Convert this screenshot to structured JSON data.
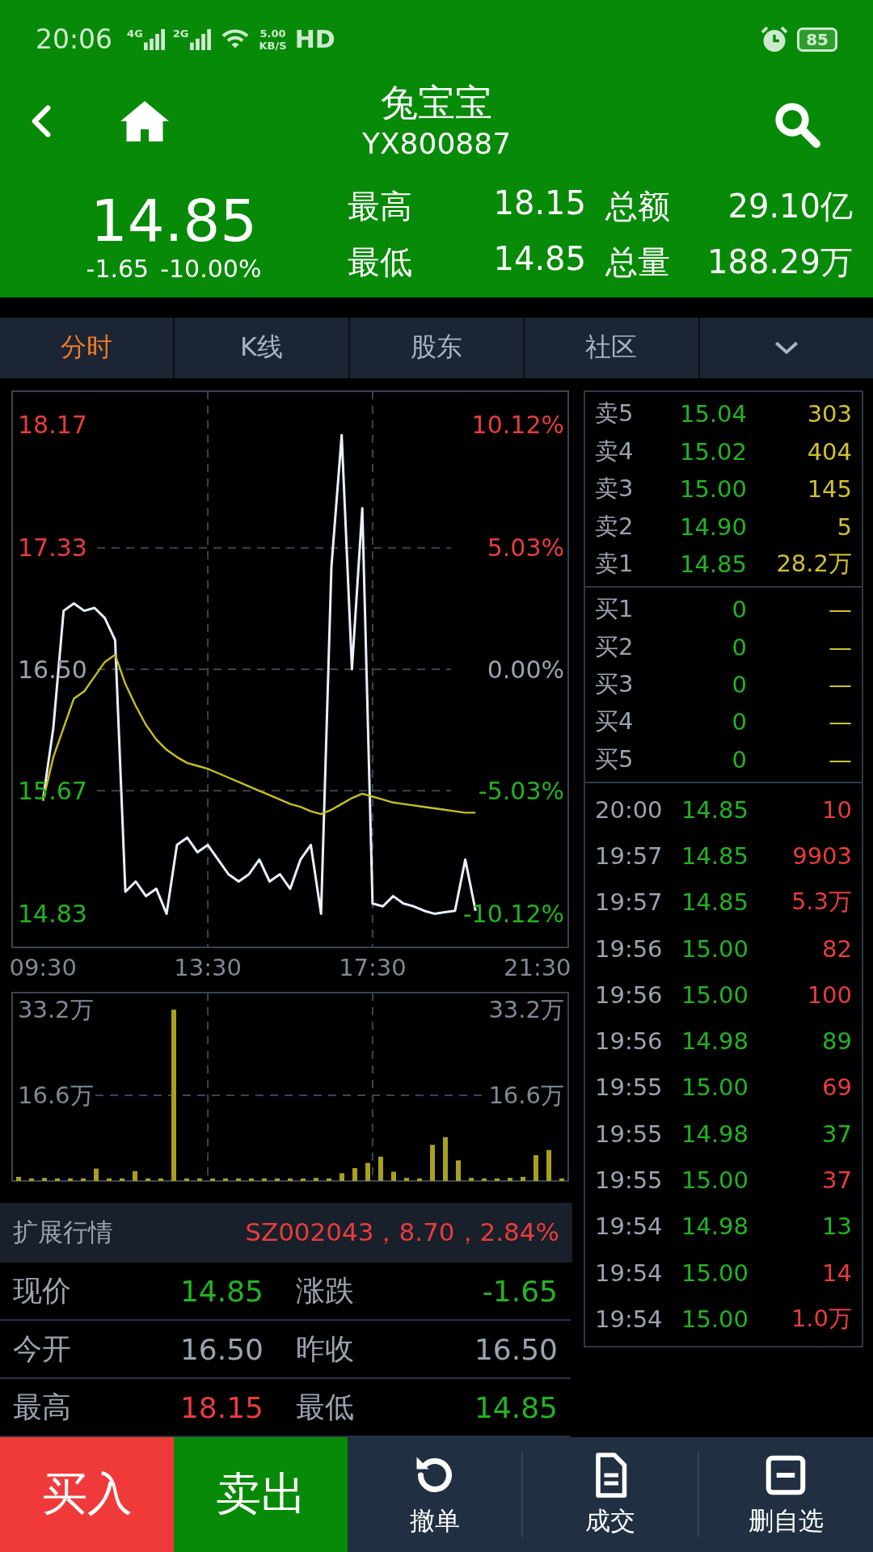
{
  "status_bar": {
    "time": "20:06",
    "networks": [
      "4G",
      "2G"
    ],
    "speed_value": "5.00",
    "speed_unit": "KB/S",
    "hd": "HD",
    "battery": "85"
  },
  "header": {
    "title": "兔宝宝",
    "code": "YX800887",
    "price": "14.85",
    "change": "-1.65",
    "change_pct": "-10.00%",
    "stats": [
      {
        "label": "最高",
        "value": "18.15"
      },
      {
        "label": "总额",
        "value": "29.10亿"
      },
      {
        "label": "最低",
        "value": "14.85"
      },
      {
        "label": "总量",
        "value": "188.29万"
      }
    ]
  },
  "tabs": [
    {
      "label": "分时",
      "selected": true
    },
    {
      "label": "K线",
      "selected": false
    },
    {
      "label": "股东",
      "selected": false
    },
    {
      "label": "社区",
      "selected": false
    }
  ],
  "price_chart": {
    "pct_labels": [
      "10.12%",
      "5.03%",
      "0.00%",
      "-5.03%",
      "-10.12%"
    ],
    "chart_data": {
      "type": "line",
      "grid": true,
      "ref_lines": [
        {
          "axis": "y",
          "value": 17.33
        },
        {
          "axis": "y",
          "value": 16.5
        },
        {
          "axis": "y",
          "value": 15.67
        }
      ],
      "xlim": [
        8.75,
        22.25
      ],
      "ylim": [
        14.6,
        18.4
      ],
      "xticks": [
        {
          "value": 9.5,
          "label": "09:30"
        },
        {
          "value": 13.5,
          "label": "13:30"
        },
        {
          "value": 17.5,
          "label": "17:30"
        },
        {
          "value": 21.5,
          "label": "21:30"
        }
      ],
      "yticks": [
        {
          "value": 18.17,
          "label": "18.17"
        },
        {
          "value": 17.33,
          "label": "17.33"
        },
        {
          "value": 16.5,
          "label": "16.50"
        },
        {
          "value": 15.67,
          "label": "15.67"
        },
        {
          "value": 14.83,
          "label": "14.83"
        }
      ],
      "x": [
        9.5,
        9.75,
        10,
        10.25,
        10.5,
        10.75,
        11,
        11.25,
        11.5,
        11.75,
        12,
        12.25,
        12.5,
        12.75,
        13,
        13.25,
        13.5,
        13.75,
        14,
        14.25,
        14.5,
        14.75,
        15,
        15.25,
        15.5,
        15.75,
        16,
        16.25,
        16.5,
        16.75,
        17,
        17.25,
        17.5,
        17.75,
        18,
        18.25,
        18.5,
        18.75,
        19,
        19.25,
        19.5,
        19.75,
        20
      ],
      "series": [
        {
          "color": "#e8f0ff",
          "values": [
            15.61,
            16.1,
            16.9,
            16.95,
            16.9,
            16.92,
            16.85,
            16.7,
            14.98,
            15.05,
            14.95,
            15.0,
            14.83,
            15.3,
            15.35,
            15.25,
            15.3,
            15.2,
            15.1,
            15.05,
            15.1,
            15.2,
            15.05,
            15.1,
            15.0,
            15.2,
            15.3,
            14.83,
            17.2,
            18.1,
            16.5,
            17.6,
            14.9,
            14.88,
            14.95,
            14.9,
            14.88,
            14.85,
            14.83,
            14.84,
            14.85,
            15.2,
            14.85
          ]
        },
        {
          "color": "#c8c020",
          "values": [
            15.6,
            15.9,
            16.1,
            16.3,
            16.35,
            16.45,
            16.55,
            16.6,
            16.4,
            16.25,
            16.12,
            16.02,
            15.95,
            15.9,
            15.86,
            15.84,
            15.82,
            15.79,
            15.76,
            15.73,
            15.7,
            15.67,
            15.64,
            15.61,
            15.58,
            15.56,
            15.53,
            15.51,
            15.54,
            15.58,
            15.62,
            15.65,
            15.63,
            15.61,
            15.59,
            15.58,
            15.57,
            15.56,
            15.55,
            15.54,
            15.53,
            15.52,
            15.52
          ]
        }
      ]
    }
  },
  "volume_chart": {
    "right_labels": [
      "33.2万",
      "16.6万"
    ],
    "chart_data": {
      "type": "bar",
      "grid": true,
      "ylim": [
        0,
        36.5
      ],
      "yticks": [
        {
          "value": 33.2,
          "label": "33.2万"
        },
        {
          "value": 16.6,
          "label": "16.6万"
        }
      ],
      "categories": [
        null,
        null,
        null,
        null,
        null,
        null,
        null,
        null,
        null,
        null,
        null,
        null,
        null,
        null,
        null,
        null,
        null,
        null,
        null,
        null,
        null,
        null,
        null,
        null,
        null,
        null,
        null,
        null,
        null,
        null,
        null,
        null,
        null,
        null,
        null,
        null,
        null,
        null,
        null,
        null,
        null,
        null,
        null
      ],
      "series": [
        {
          "color": "#a8a020",
          "values": [
            0.8,
            0.5,
            0.6,
            0.5,
            0.5,
            0.5,
            2.4,
            0.5,
            0.5,
            1.9,
            0.5,
            0.5,
            33.2,
            0.5,
            0.5,
            0.5,
            0.5,
            0.5,
            0.5,
            0.5,
            0.5,
            0.5,
            0.5,
            0.6,
            0.5,
            1.5,
            2.5,
            3.5,
            4.7,
            1.8,
            0.6,
            0.5,
            7.0,
            8.5,
            4.0,
            0.6,
            0.5,
            0.5,
            0.6,
            0.8,
            5.0,
            6.0,
            0.5
          ]
        }
      ]
    }
  },
  "extended": {
    "label": "扩展行情",
    "value": "SZ002043，8.70，2.84%"
  },
  "quote_rows": [
    [
      {
        "label": "现价",
        "value": "14.85",
        "color": "#22b422"
      },
      {
        "label": "涨跌",
        "value": "-1.65",
        "color": "#22b422"
      }
    ],
    [
      {
        "label": "今开",
        "value": "16.50",
        "color": "#9aa4b0"
      },
      {
        "label": "昨收",
        "value": "16.50",
        "color": "#9aa4b0"
      }
    ],
    [
      {
        "label": "最高",
        "value": "18.15",
        "color": "#e83c3c"
      },
      {
        "label": "最低",
        "value": "14.85",
        "color": "#22b422"
      }
    ]
  ],
  "sell_orders": [
    {
      "label": "卖5",
      "price": "15.04",
      "volume": "303"
    },
    {
      "label": "卖4",
      "price": "15.02",
      "volume": "404"
    },
    {
      "label": "卖3",
      "price": "15.00",
      "volume": "145"
    },
    {
      "label": "卖2",
      "price": "14.90",
      "volume": "5"
    },
    {
      "label": "卖1",
      "price": "14.85",
      "volume": "28.2万"
    }
  ],
  "buy_orders": [
    {
      "label": "买1",
      "price": "0",
      "volume": "—"
    },
    {
      "label": "买2",
      "price": "0",
      "volume": "—"
    },
    {
      "label": "买3",
      "price": "0",
      "volume": "—"
    },
    {
      "label": "买4",
      "price": "0",
      "volume": "—"
    },
    {
      "label": "买5",
      "price": "0",
      "volume": "—"
    }
  ],
  "trades": [
    {
      "time": "20:00",
      "price": "14.85",
      "volume": "10",
      "color": "#e83c3c"
    },
    {
      "time": "19:57",
      "price": "14.85",
      "volume": "9903",
      "color": "#e83c3c"
    },
    {
      "time": "19:57",
      "price": "14.85",
      "volume": "5.3万",
      "color": "#e83c3c"
    },
    {
      "time": "19:56",
      "price": "15.00",
      "volume": "82",
      "color": "#e83c3c"
    },
    {
      "time": "19:56",
      "price": "15.00",
      "volume": "100",
      "color": "#e83c3c"
    },
    {
      "time": "19:56",
      "price": "14.98",
      "volume": "89",
      "color": "#22b422"
    },
    {
      "time": "19:55",
      "price": "15.00",
      "volume": "69",
      "color": "#e83c3c"
    },
    {
      "time": "19:55",
      "price": "14.98",
      "volume": "37",
      "color": "#22b422"
    },
    {
      "time": "19:55",
      "price": "15.00",
      "volume": "37",
      "color": "#e83c3c"
    },
    {
      "time": "19:54",
      "price": "14.98",
      "volume": "13",
      "color": "#22b422"
    },
    {
      "time": "19:54",
      "price": "15.00",
      "volume": "14",
      "color": "#e83c3c"
    },
    {
      "time": "19:54",
      "price": "15.00",
      "volume": "1.0万",
      "color": "#e83c3c"
    }
  ],
  "bottom_bar": [
    {
      "label": "买入",
      "kind": "buy"
    },
    {
      "label": "卖出",
      "kind": "sell"
    },
    {
      "label": "撤单",
      "kind": "undo"
    },
    {
      "label": "成交",
      "kind": "document"
    },
    {
      "label": "删自选",
      "kind": "remove"
    }
  ]
}
